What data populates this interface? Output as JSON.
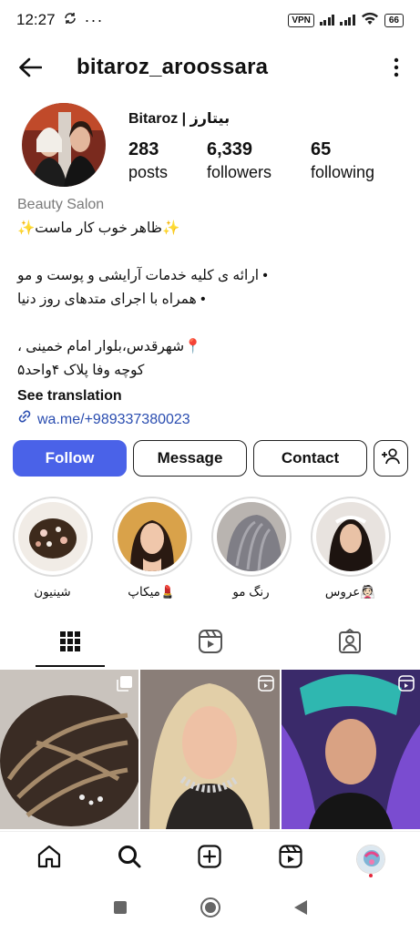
{
  "status": {
    "time": "12:27",
    "vpn": "VPN",
    "battery": "66"
  },
  "header": {
    "username": "bitaroz_aroossara"
  },
  "profile": {
    "name": "Bitaroz | بیتارز",
    "stats": [
      {
        "value": "283",
        "label": "posts"
      },
      {
        "value": "6,339",
        "label": "followers"
      },
      {
        "value": "65",
        "label": "following"
      }
    ],
    "category": "Beauty Salon",
    "bio_lines": [
      "✨ظاهر خوب کار ماست✨",
      "",
      "• ارائه ی کلیه خدمات آرایشی و پوست و مو",
      "• همراه با اجرای متدهای روز دنیا",
      "",
      "📍شهرقدس،بلوار امام خمینی ،",
      "کوچه وفا پلاک ۴واحد۵"
    ],
    "see_translation": "See translation",
    "link": "wa.me/+989337380023"
  },
  "actions": {
    "follow": "Follow",
    "message": "Message",
    "contact": "Contact"
  },
  "highlights": [
    {
      "label": "شینیون"
    },
    {
      "label": "💄میکاپ"
    },
    {
      "label": "رنگ مو"
    },
    {
      "label": "👰🏻عروس"
    }
  ],
  "colors": {
    "accent": "#4a62e8",
    "link": "#2a4db0",
    "category": "#7a7a7a"
  }
}
